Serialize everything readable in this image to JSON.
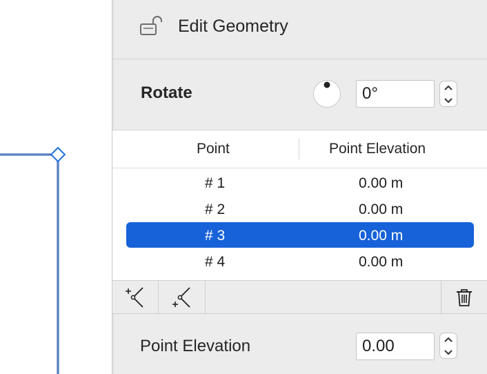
{
  "header": {
    "title": "Edit Geometry"
  },
  "rotate": {
    "label": "Rotate",
    "value": "0°"
  },
  "table": {
    "columns": [
      "Point",
      "Point Elevation"
    ],
    "rows": [
      {
        "point": "# 1",
        "elevation": "0.00 m",
        "selected": false
      },
      {
        "point": "# 2",
        "elevation": "0.00 m",
        "selected": false
      },
      {
        "point": "# 3",
        "elevation": "0.00 m",
        "selected": true
      },
      {
        "point": "# 4",
        "elevation": "0.00 m",
        "selected": false
      }
    ]
  },
  "toolbar": {
    "icons": [
      "add-point-before-icon",
      "add-point-after-icon",
      "trash-icon"
    ]
  },
  "point_elevation": {
    "label": "Point Elevation",
    "value": "0.00"
  },
  "colors": {
    "selection": "#1762d8",
    "geometry": "#1f4fa3",
    "panel": "#ececec"
  }
}
